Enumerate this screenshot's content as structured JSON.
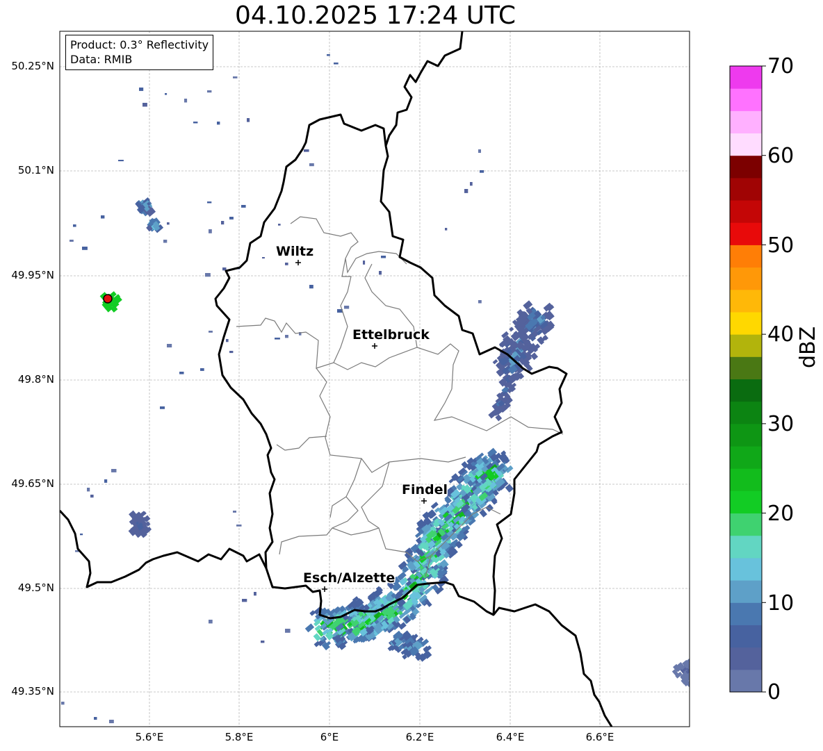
{
  "title": "04.10.2025 17:24 UTC",
  "info": {
    "product": "Product: 0.3° Reflectivity",
    "data": "Data: RMIB"
  },
  "lat_ticks": [
    "50.25°N",
    "50.1°N",
    "49.95°N",
    "49.8°N",
    "49.65°N",
    "49.5°N",
    "49.35°N"
  ],
  "lon_ticks": [
    "5.6°E",
    "5.8°E",
    "6°E",
    "6.2°E",
    "6.4°E",
    "6.6°E"
  ],
  "colorbar": {
    "label": "dBZ",
    "ticks": [
      "0",
      "10",
      "20",
      "30",
      "40",
      "50",
      "60",
      "70"
    ],
    "colors": [
      "#6878aa",
      "#54629c",
      "#4762a0",
      "#4a78b0",
      "#5ea0c8",
      "#68c2dc",
      "#62d6c2",
      "#3fd270",
      "#12cc24",
      "#12bc1c",
      "#10a818",
      "#0e9614",
      "#0c8412",
      "#0a6c10",
      "#4a7814",
      "#b2b40c",
      "#ffd800",
      "#ffb808",
      "#ff9808",
      "#ff7e06",
      "#e80a0a",
      "#c40606",
      "#a00404",
      "#7c0000",
      "#ffdcff",
      "#ffb0ff",
      "#ff72ff",
      "#ee3aee"
    ]
  },
  "cities": [
    {
      "name": "Wiltz"
    },
    {
      "name": "Ettelbruck"
    },
    {
      "name": "Findel"
    },
    {
      "name": "Esch/Alzette"
    }
  ]
}
